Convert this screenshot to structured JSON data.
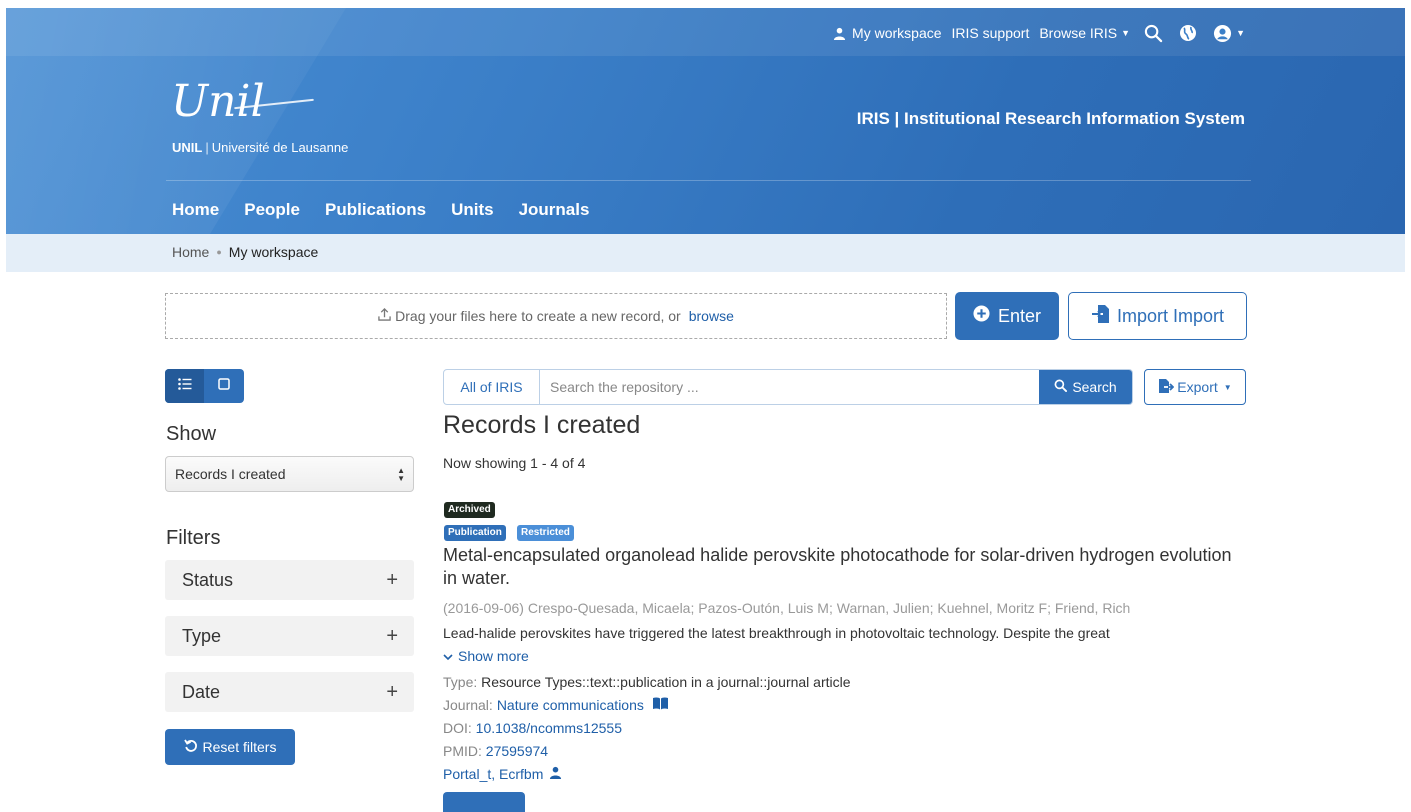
{
  "topbar": {
    "workspace": "My workspace",
    "support": "IRIS support",
    "browse": "Browse IRIS"
  },
  "logo": {
    "script": "Unil",
    "abbr": "UNIL",
    "sep": "|",
    "name": "Université de Lausanne"
  },
  "site_title": "IRIS | Institutional Research Information System",
  "nav": [
    "Home",
    "People",
    "Publications",
    "Units",
    "Journals"
  ],
  "breadcrumb": {
    "home": "Home",
    "current": "My workspace"
  },
  "dropzone": {
    "text": "Drag your files here to create a new record, or",
    "link": "browse"
  },
  "actions": {
    "enter": "Enter",
    "import": "Import Import"
  },
  "sidebar": {
    "show_label": "Show",
    "show_value": "Records I created",
    "filters_label": "Filters",
    "filters": [
      "Status",
      "Type",
      "Date"
    ],
    "reset": "Reset filters"
  },
  "search": {
    "scope": "All of IRIS",
    "placeholder": "Search the repository ...",
    "button": "Search",
    "export": "Export"
  },
  "results": {
    "title": "Records I created",
    "showing": "Now showing 1 - 4 of 4"
  },
  "record": {
    "badge_status": "Archived",
    "badge_type": "Publication",
    "badge_access": "Restricted",
    "title": "Metal-encapsulated organolead halide perovskite photocathode for solar-driven hydrogen evolution in water.",
    "authors": "(2016-09-06) Crespo-Quesada, Micaela; Pazos-Outón, Luis M; Warnan, Julien; Kuehnel, Moritz F; Friend, Rich",
    "abstract": "Lead-halide perovskites have triggered the latest breakthrough in photovoltaic technology. Despite the great",
    "show_more": "Show more",
    "type_label": "Type:",
    "type_value": "Resource Types::text::publication in a journal::journal article",
    "journal_label": "Journal:",
    "journal_value": "Nature communications",
    "doi_label": "DOI:",
    "doi_value": "10.1038/ncomms12555",
    "pmid_label": "PMID:",
    "pmid_value": "27595974",
    "owner": "Portal_t, Ecrfbm"
  },
  "colors": {
    "primary": "#2f6fb8",
    "header": "#3b7fc8",
    "breadcrumb_bg": "#e4eef8",
    "archived": "#1f2a20"
  },
  "icons": [
    "user-icon",
    "search-icon",
    "globe-icon",
    "account-icon",
    "upload-icon",
    "plus-circle-icon",
    "import-icon",
    "list-icon",
    "square-icon",
    "reset-icon",
    "export-icon",
    "chevron-down-icon",
    "book-icon"
  ]
}
